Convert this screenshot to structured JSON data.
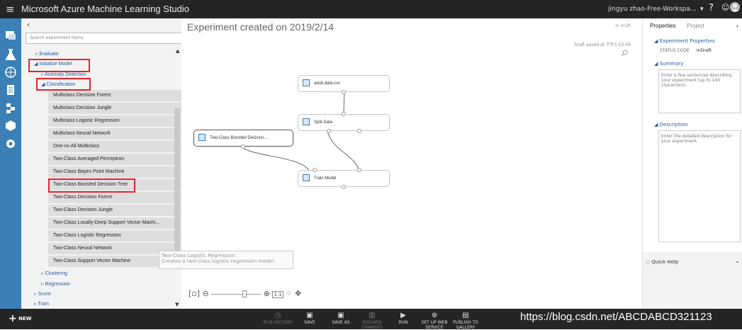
{
  "app": {
    "title": "Microsoft Azure Machine Learning Studio",
    "workspace": "jingyu zhao-Free-Workspa..."
  },
  "palette": {
    "search_placeholder": "Search experiment items",
    "tree": {
      "evaluate": "Evaluate",
      "initialize_model": "Initialize Model",
      "anomaly_detection": "Anomaly Detection",
      "classification": "Classification",
      "clustering": "Clustering",
      "regression": "Regression",
      "score": "Score",
      "train": "Train"
    },
    "items": [
      "Multiclass Decision Forest",
      "Multiclass Decision Jungle",
      "Multiclass Logistic Regression",
      "Multiclass Neural Network",
      "One-vs-All Multiclass",
      "Two-Class Averaged Perceptron",
      "Two-Class Bayes Point Machine",
      "Two-Class Boosted Decision Tree",
      "Two-Class Decision Forest",
      "Two-Class Decision Jungle",
      "Two-Class Locally-Deep Support Vector Machi...",
      "Two-Class Logistic Regression",
      "Two-Class Neural Network",
      "Two-Class Support Vector Machine"
    ]
  },
  "canvas": {
    "title": "Experiment created on 2019/2/14",
    "status": "In draft",
    "draft_saved": "Draft saved at 下午1:53:04",
    "modules": {
      "dataset": "adult.data.csv",
      "split": "Split Data",
      "boosted": "Two-Class Boosted Decision...",
      "train": "Train Model"
    },
    "tooltip": {
      "title": "Two-Class Logistic Regression",
      "desc": "Creates a two-class logistic regression model"
    },
    "zoom_label": "1:1"
  },
  "properties": {
    "tab_active": "Properties",
    "tab_other": "Project",
    "section_exp": "Experiment Properties",
    "status_label": "STATUS CODE",
    "status_value": "InDraft",
    "summary_head": "Summary",
    "summary_placeholder": "Enter a few sentences describing your experiment (up to 140 characters).",
    "desc_head": "Description",
    "desc_placeholder": "Enter the detailed description for your experiment.",
    "quick_help": "Quick Help"
  },
  "bottom": {
    "new": "NEW",
    "buttons": [
      "RUN HISTORY",
      "SAVE",
      "SAVE AS",
      "DISCARD CHANGES",
      "RUN",
      "SET UP WEB SERVICE",
      "PUBLISH TO GALLERY"
    ],
    "watermark": "https://blog.csdn.net/ABCDABCD321123"
  }
}
